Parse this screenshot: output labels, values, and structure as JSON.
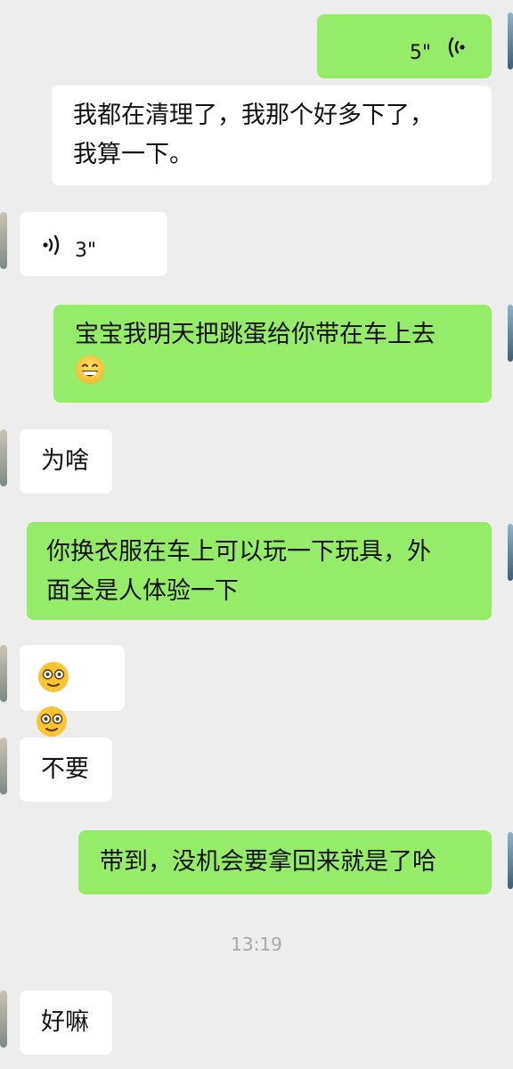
{
  "chat": {
    "messages": [
      {
        "side": "sent",
        "type": "voice",
        "duration": "5\""
      },
      {
        "side": "received",
        "type": "text",
        "text": "我都在清理了，我那个好多下了，\n我算一下。"
      },
      {
        "side": "received",
        "type": "voice",
        "duration": "3\""
      },
      {
        "side": "sent",
        "type": "text",
        "text": "宝宝我明天把跳蛋给你带在车上去",
        "emoji": "grinning-face"
      },
      {
        "side": "received",
        "type": "text",
        "text": "为啥"
      },
      {
        "side": "sent",
        "type": "text",
        "text": "你换衣服在车上可以玩一下玩具，外\n面全是人体验一下"
      },
      {
        "side": "received",
        "type": "emoji",
        "emojis": [
          "face-with-spiral-eyes",
          "face-with-spiral-eyes"
        ]
      },
      {
        "side": "received",
        "type": "text",
        "text": "不要"
      },
      {
        "side": "sent",
        "type": "text",
        "text": "带到，没机会要拿回来就是了哈"
      },
      {
        "side": "received",
        "type": "text",
        "text": "好嘛"
      }
    ],
    "timestamp": "13:19"
  },
  "colors": {
    "background": "#ededed",
    "sent_bubble": "#95ec69",
    "received_bubble": "#ffffff",
    "timestamp_text": "#a8a8a8"
  }
}
